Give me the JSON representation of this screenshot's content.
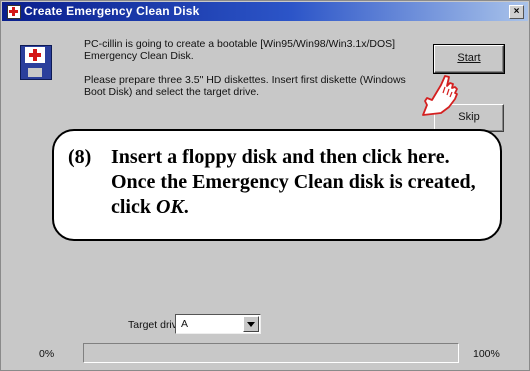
{
  "window": {
    "title": "Create Emergency Clean Disk",
    "close_glyph": "×"
  },
  "message": {
    "line1": "PC-cillin is going to create a bootable [Win95/Win98/Win3.1x/DOS] Emergency Clean Disk.",
    "line2": "Please prepare three 3.5\" HD diskettes. Insert first diskette (Windows Boot Disk) and select the target drive."
  },
  "buttons": {
    "start": "Start",
    "skip": "Skip"
  },
  "callout": {
    "number": "(8)",
    "text_before_ok": "Insert a floppy disk and then click here. Once the Emergency Clean disk is created, click ",
    "ok": "OK",
    "text_after_ok": "."
  },
  "target_drive": {
    "label": "Target drive:",
    "value": "A"
  },
  "progress": {
    "start_label": "0%",
    "end_label": "100%",
    "value": 0
  },
  "colors": {
    "title_bar": "#0a1f8c",
    "window_bg": "#c8c8c8",
    "progress_fill": "#2c46b6"
  },
  "icons": [
    "red-cross-app-icon",
    "close-icon",
    "pointing-hand-icon",
    "chevron-down-icon"
  ]
}
